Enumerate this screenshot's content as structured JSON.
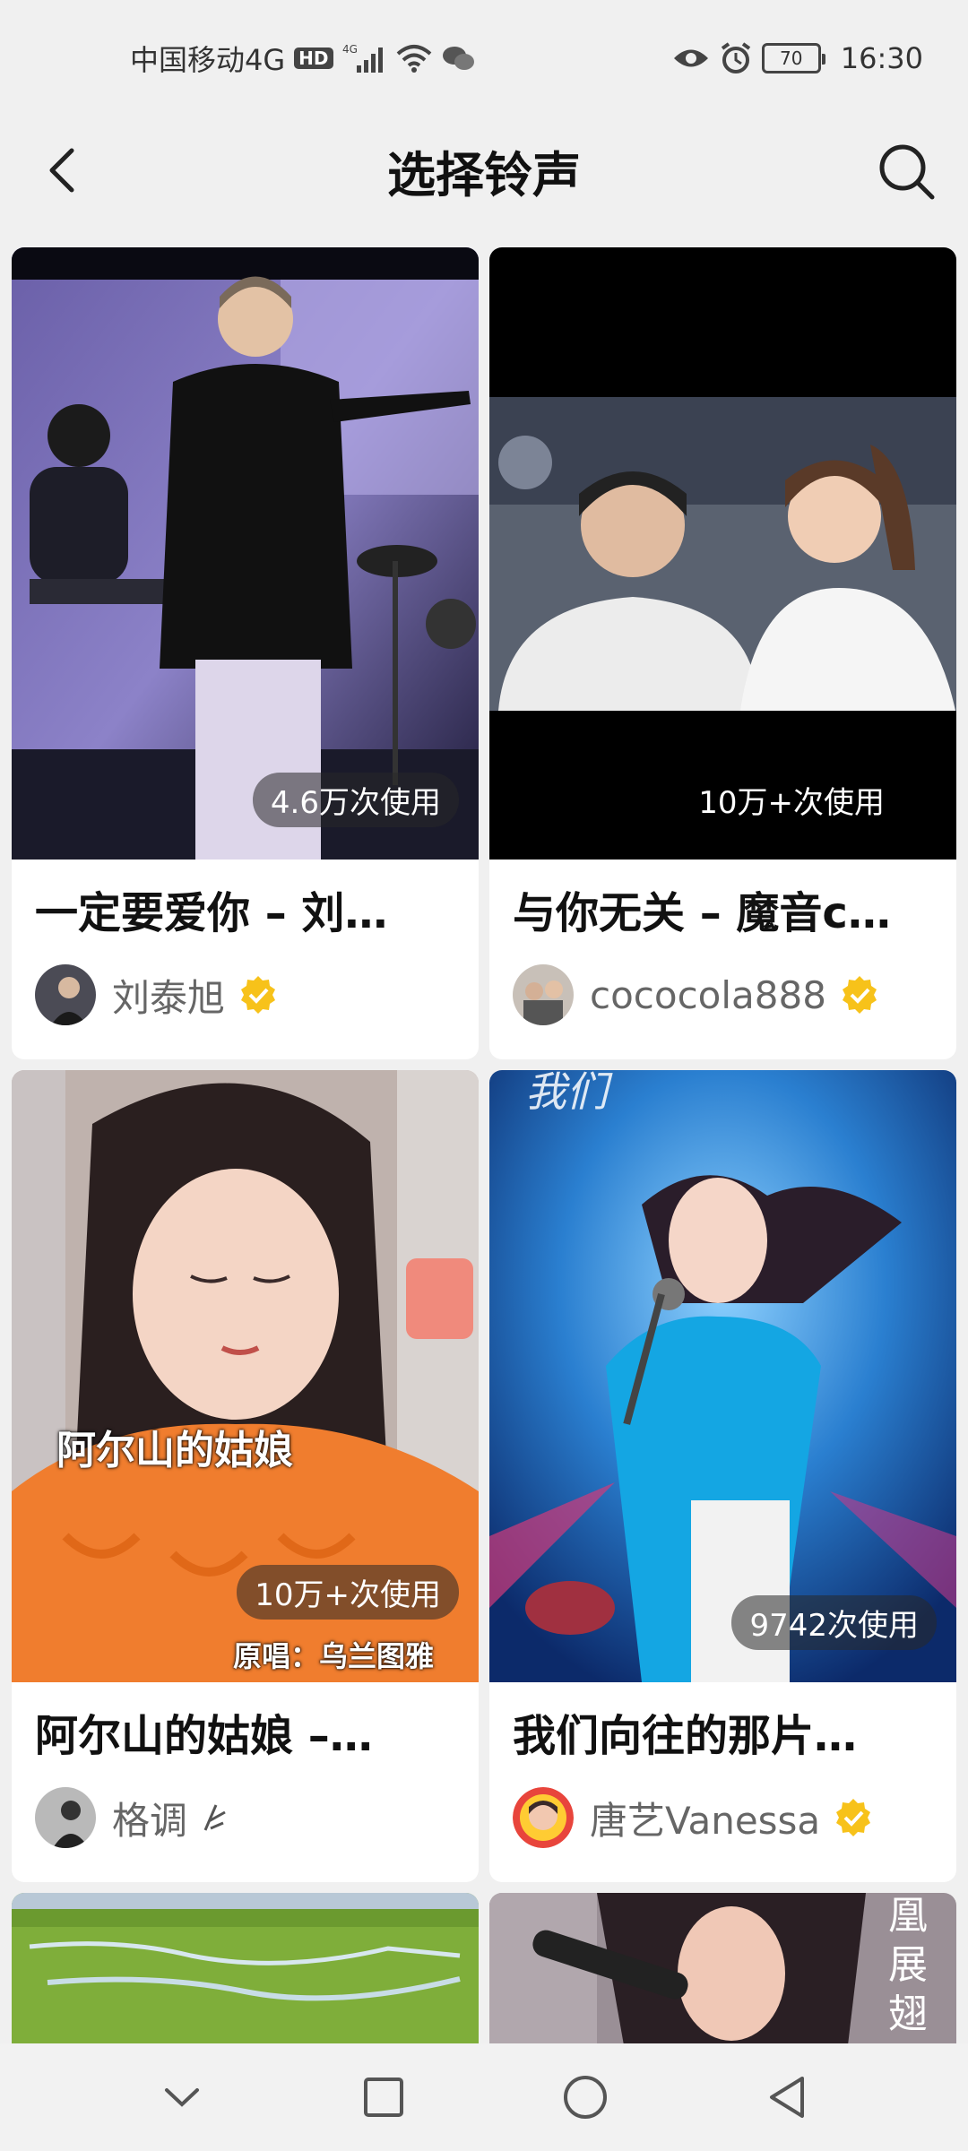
{
  "status_bar": {
    "carrier": "中国移动4G",
    "hd": "HD",
    "battery": "70",
    "time": "16:30"
  },
  "header": {
    "title": "选择铃声"
  },
  "cards": [
    {
      "title": "一定要爱你 – 刘…",
      "author": "刘泰旭",
      "usage": "4.6万次使用",
      "verified": true
    },
    {
      "title": "与你无关 – 魔音c…",
      "author": "cococola888",
      "usage": "10万+次使用",
      "verified": true
    },
    {
      "title": "阿尔山的姑娘 –…",
      "author": "格调",
      "usage": "10万+次使用",
      "overlay_big": "阿尔山的姑娘",
      "overlay_small": "原唱：乌兰图雅",
      "verified": false
    },
    {
      "title": "我们向往的那片…",
      "author": "唐艺Vanessa",
      "usage": "9742次使用",
      "verified": true
    }
  ]
}
